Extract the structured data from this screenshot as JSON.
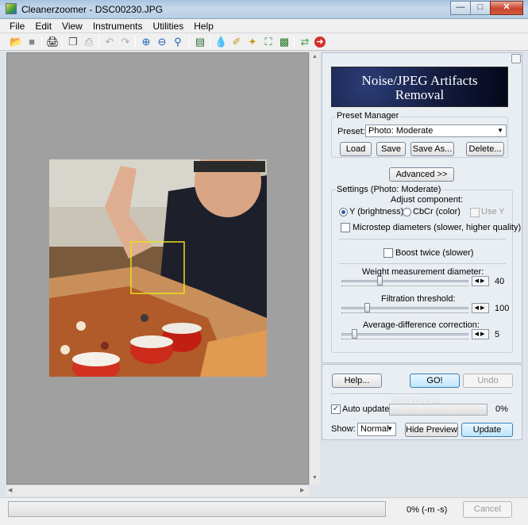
{
  "window": {
    "title": "Cleanerzoomer - DSC00230.JPG"
  },
  "menubar": {
    "items": [
      "File",
      "Edit",
      "View",
      "Instruments",
      "Utilities",
      "Help"
    ]
  },
  "toolbar": {
    "icons": [
      "open-icon",
      "save-icon",
      "print-icon",
      "copy-icon",
      "paste-icon",
      "undo-icon",
      "redo-icon",
      "zoom-in-icon",
      "zoom-out-icon",
      "zoom-actual-icon",
      "histogram-icon",
      "drop-icon",
      "brush-icon",
      "wand-icon",
      "fit-icon",
      "image-icon",
      "arrows-icon",
      "stop-icon"
    ]
  },
  "panel": {
    "banner_line1": "Noise/JPEG Artifacts",
    "banner_line2": "Removal",
    "preset_manager": {
      "label": "Preset Manager",
      "preset_label": "Preset:",
      "preset_value": "Photo: Moderate",
      "load": "Load",
      "save": "Save",
      "save_as": "Save As...",
      "delete": "Delete..."
    },
    "advanced": "Advanced >>",
    "settings": {
      "label": "Settings (Photo: Moderate)",
      "adjust_component": "Adjust component:",
      "y_brightness": "Y (brightness)",
      "cbcr": "CbCr (color)",
      "use_y": "Use Y",
      "microstep": "Microstep diameters (slower, higher quality)",
      "boost_twice": "Boost twice (slower)",
      "weight_label": "Weight measurement diameter:",
      "weight_value": "40",
      "weight_level": 0.3,
      "filtration_label": "Filtration threshold:",
      "filtration_value": "100",
      "filtration_level": 0.18,
      "avgdiff_label": "Average-difference correction:",
      "avgdiff_value": "5",
      "avgdiff_level": 0.08
    }
  },
  "bottom": {
    "help": "Help...",
    "go": "GO!",
    "undo": "Undo",
    "auto_update": "Auto update",
    "progress_value": "0%",
    "show_label": "Show:",
    "show_value": "Normal",
    "hide_preview": "Hide Preview",
    "update": "Update",
    "watermark": "SOFT32.com"
  },
  "status": {
    "progress_text": "0% (-m -s)",
    "cancel": "Cancel"
  }
}
